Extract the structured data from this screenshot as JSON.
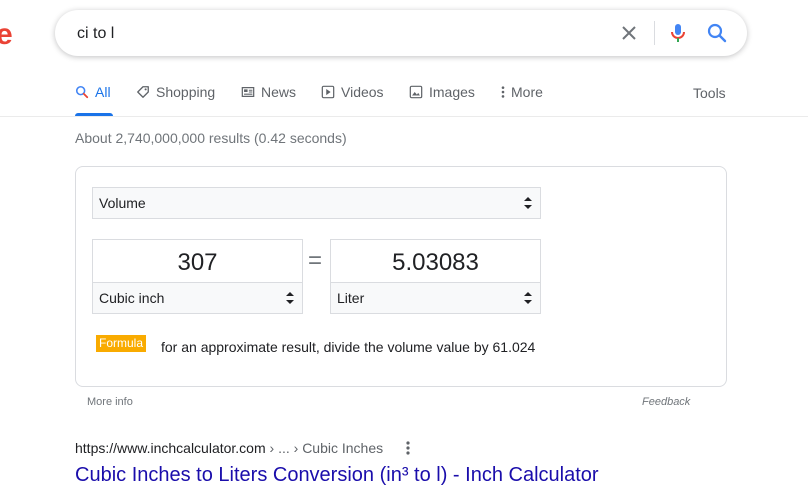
{
  "logo_fragment": "e",
  "search": {
    "query": "ci to l"
  },
  "tabs": [
    {
      "label": "All",
      "icon": "search-icon"
    },
    {
      "label": "Shopping",
      "icon": "tag-icon"
    },
    {
      "label": "News",
      "icon": "newspaper-icon"
    },
    {
      "label": "Videos",
      "icon": "play-icon"
    },
    {
      "label": "Images",
      "icon": "image-icon"
    },
    {
      "label": "More",
      "icon": "kebab-icon"
    }
  ],
  "tools_label": "Tools",
  "result_stats": "About 2,740,000,000 results (0.42 seconds)",
  "converter": {
    "category": "Volume",
    "from_value": "307",
    "from_unit": "Cubic inch",
    "equals": "=",
    "to_value": "5.03083",
    "to_unit": "Liter",
    "formula_label": "Formula",
    "formula_text": "for an approximate result, divide the volume value by 61.024"
  },
  "more_info_label": "More info",
  "feedback_label": "Feedback",
  "result": {
    "url_base": "https://www.inchcalculator.com",
    "url_crumbs": " › ... › Cubic Inches",
    "title": "Cubic Inches to Liters Conversion (in³ to l) - Inch Calculator"
  },
  "colors": {
    "accent": "#1a73e8",
    "link": "#1a0dab",
    "formula_badge": "#f9ab00",
    "logo_red": "#ea4335"
  }
}
